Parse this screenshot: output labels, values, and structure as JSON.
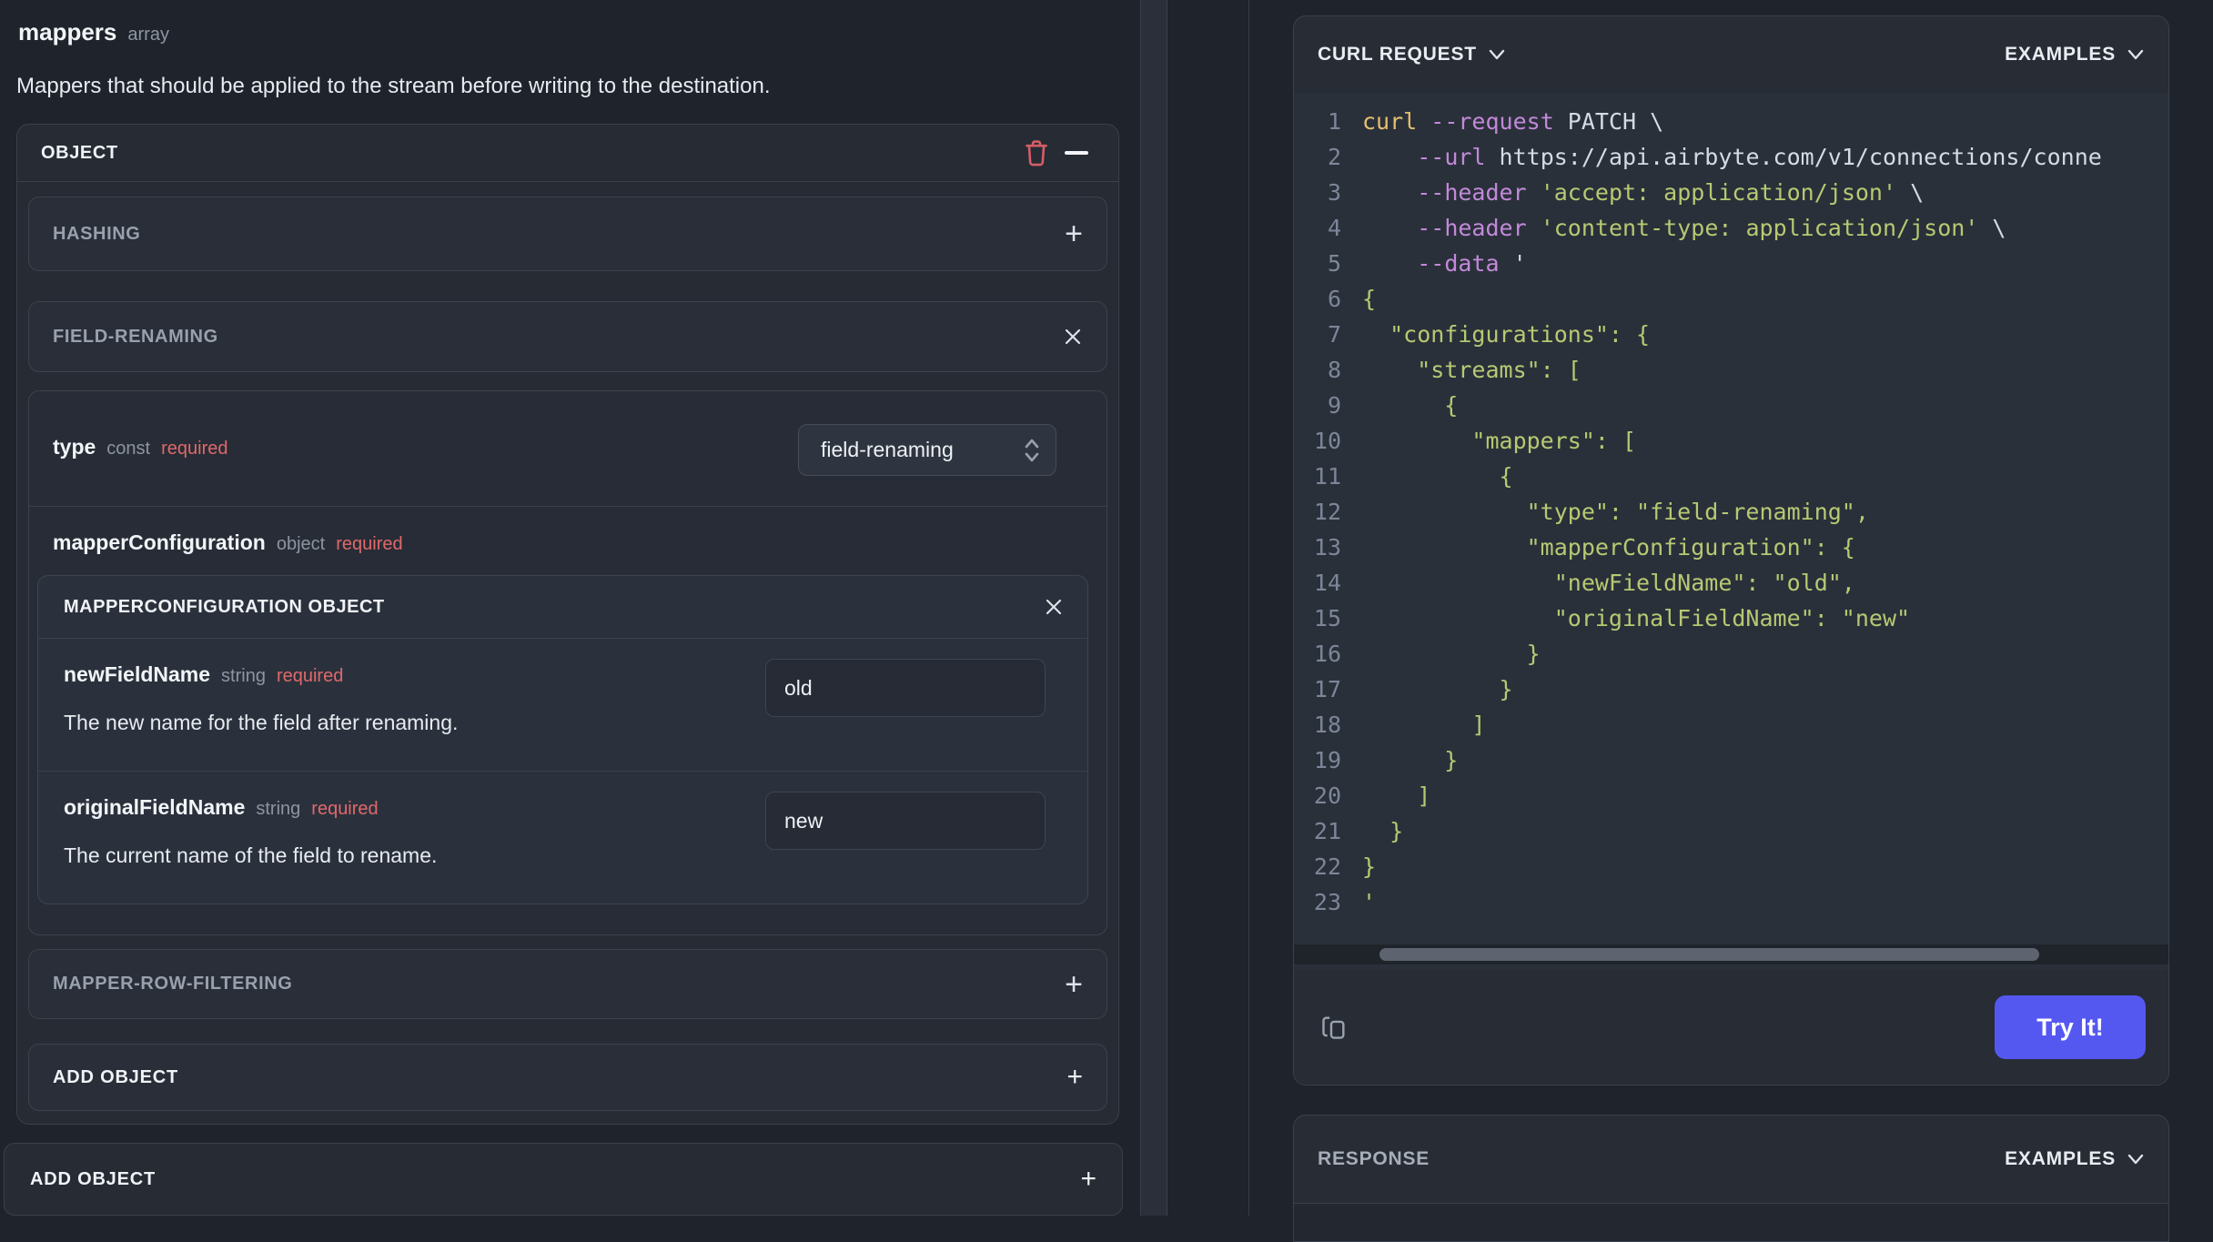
{
  "left": {
    "field_title": "mappers",
    "field_type": "array",
    "description": "Mappers that should be applied to the stream before writing to the destination.",
    "object_panel": {
      "title": "OBJECT",
      "hashing_label": "HASHING",
      "field_renaming_label": "FIELD-RENAMING",
      "mapper_row_filtering_label": "MAPPER-ROW-FILTERING",
      "type_row": {
        "name": "type",
        "kind": "const",
        "required": "required",
        "value": "field-renaming"
      },
      "mapper_configuration": {
        "name": "mapperConfiguration",
        "kind": "object",
        "required": "required",
        "card_title": "MAPPERCONFIGURATION OBJECT",
        "fields": [
          {
            "name": "newFieldName",
            "kind": "string",
            "required": "required",
            "value": "old",
            "description": "The new name for the field after renaming."
          },
          {
            "name": "originalFieldName",
            "kind": "string",
            "required": "required",
            "value": "new",
            "description": "The current name of the field to rename."
          }
        ]
      },
      "add_object_label": "ADD OBJECT"
    },
    "outer_add_object_label": "ADD OBJECT"
  },
  "right": {
    "curl_panel": {
      "title": "CURL REQUEST",
      "examples_label": "EXAMPLES",
      "try_button_label": "Try It!",
      "code_lines": [
        {
          "n": "1",
          "parts": [
            [
              "curl",
              "kw"
            ],
            [
              " ",
              "plain"
            ],
            [
              "--request",
              "flag"
            ],
            [
              " PATCH \\",
              "plain"
            ]
          ]
        },
        {
          "n": "2",
          "parts": [
            [
              "    ",
              "plain"
            ],
            [
              "--url",
              "flag"
            ],
            [
              " https://api.airbyte.com/v1/connections/conne",
              "plain"
            ]
          ]
        },
        {
          "n": "3",
          "parts": [
            [
              "    ",
              "plain"
            ],
            [
              "--header",
              "flag"
            ],
            [
              " ",
              "plain"
            ],
            [
              "'accept: application/json'",
              "str"
            ],
            [
              " \\",
              "plain"
            ]
          ]
        },
        {
          "n": "4",
          "parts": [
            [
              "    ",
              "plain"
            ],
            [
              "--header",
              "flag"
            ],
            [
              " ",
              "plain"
            ],
            [
              "'content-type: application/json'",
              "str"
            ],
            [
              " \\",
              "plain"
            ]
          ]
        },
        {
          "n": "5",
          "parts": [
            [
              "    ",
              "plain"
            ],
            [
              "--data",
              "flag"
            ],
            [
              " '",
              "plain"
            ]
          ]
        },
        {
          "n": "6",
          "parts": [
            [
              "{",
              "str"
            ]
          ]
        },
        {
          "n": "7",
          "parts": [
            [
              "  \"configurations\": {",
              "str"
            ]
          ]
        },
        {
          "n": "8",
          "parts": [
            [
              "    \"streams\": [",
              "str"
            ]
          ]
        },
        {
          "n": "9",
          "parts": [
            [
              "      {",
              "str"
            ]
          ]
        },
        {
          "n": "10",
          "parts": [
            [
              "        \"mappers\": [",
              "str"
            ]
          ]
        },
        {
          "n": "11",
          "parts": [
            [
              "          {",
              "str"
            ]
          ]
        },
        {
          "n": "12",
          "parts": [
            [
              "            \"type\": \"field-renaming\",",
              "str"
            ]
          ]
        },
        {
          "n": "13",
          "parts": [
            [
              "            \"mapperConfiguration\": {",
              "str"
            ]
          ]
        },
        {
          "n": "14",
          "parts": [
            [
              "              \"newFieldName\": \"old\",",
              "str"
            ]
          ]
        },
        {
          "n": "15",
          "parts": [
            [
              "              \"originalFieldName\": \"new\"",
              "str"
            ]
          ]
        },
        {
          "n": "16",
          "parts": [
            [
              "            }",
              "str"
            ]
          ]
        },
        {
          "n": "17",
          "parts": [
            [
              "          }",
              "str"
            ]
          ]
        },
        {
          "n": "18",
          "parts": [
            [
              "        ]",
              "str"
            ]
          ]
        },
        {
          "n": "19",
          "parts": [
            [
              "      }",
              "str"
            ]
          ]
        },
        {
          "n": "20",
          "parts": [
            [
              "    ]",
              "str"
            ]
          ]
        },
        {
          "n": "21",
          "parts": [
            [
              "  }",
              "str"
            ]
          ]
        },
        {
          "n": "22",
          "parts": [
            [
              "}",
              "str"
            ]
          ]
        },
        {
          "n": "23",
          "parts": [
            [
              "'",
              "str"
            ]
          ]
        }
      ]
    },
    "response_panel": {
      "title": "RESPONSE",
      "examples_label": "EXAMPLES"
    }
  },
  "icons": {
    "trash": "trash-icon",
    "minus": "minus-icon",
    "plus": "plus-icon",
    "close": "close-icon",
    "chevron_down": "chevron-down-icon",
    "select_chevrons": "select-chevrons-icon",
    "copy": "copy-icon"
  },
  "colors": {
    "accent_blue": "#5558f0",
    "required_red": "#e0696b",
    "trash_red": "#d45d66",
    "code_keyword": "#e7bf6d",
    "code_flag": "#c289d9",
    "code_string": "#b7c972",
    "code_plain": "#d5dbe5",
    "line_number": "#7c8698",
    "panel_bg": "#272c35",
    "code_bg": "#2a303a"
  }
}
